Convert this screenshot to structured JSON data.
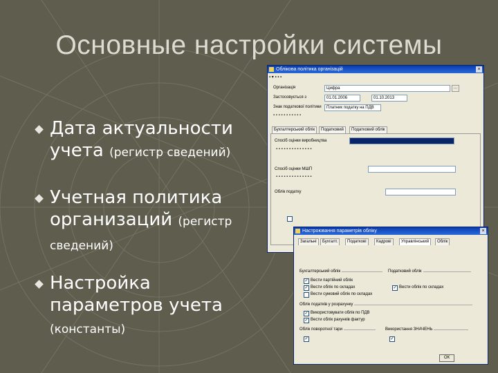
{
  "slide": {
    "title": "Основные настройки системы",
    "bullets": [
      {
        "main": "Дата актуальности учета",
        "small": "(регистр сведений)"
      },
      {
        "main": "Учетная политика организаций",
        "small": "(регистр сведений)"
      },
      {
        "main": "Настройка параметров учета",
        "small": "(константы)"
      }
    ]
  },
  "window1": {
    "title": "Облікова політика організацій",
    "fields": [
      {
        "label": "Організація",
        "value": "Цифра"
      },
      {
        "label": "Застосовується з",
        "value": "01.01.2006"
      },
      {
        "label": "Знак податкової політики",
        "value": "Платник податку на ПДВ"
      }
    ],
    "date_to": "01.10.2013",
    "tabs": [
      "Бухгалтерський облік",
      "Податковий",
      "Податковий облік"
    ],
    "sections": [
      "Спосіб оцінки виробництва",
      "Спосіб оцінки МШП",
      "Облік податку"
    ]
  },
  "window2": {
    "title": "Настроювання параметрів обліку",
    "tabs": [
      "Загальні",
      "Бухгалт.",
      "Податкові",
      "Кадрові",
      "Управлінський",
      "Облік"
    ],
    "groups": [
      "Бухгалтерський облік",
      "Податковий облік",
      "Облік податків у розрахунку",
      "Облік поворотної тари",
      "Використання ЗНАЧЕНЬ"
    ],
    "checkbox_labels": [
      "Вести партійний облік",
      "Вести облік по складах",
      "Вести сумовий облік по складах",
      "Використовувати облік по ПДВ",
      "Вести облік рахунків фактур",
      "Вести облік по складах"
    ],
    "ok_label": "ОК"
  }
}
